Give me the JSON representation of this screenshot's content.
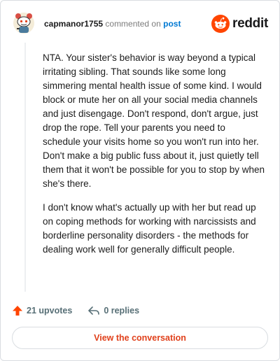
{
  "comment": {
    "username": "capmanor1755",
    "action_text": "commented on",
    "post_link": "post",
    "paragraphs": [
      "NTA. Your sister's behavior is way beyond a typical irritating sibling. That sounds like some long simmering mental health issue of some kind. I would block or mute her on all your social media channels and just disengage. Don't respond, don't argue, just drop the rope. Tell your parents you need to schedule your visits home so you won't run into her. Don't make a big public fuss about it, just quietly tell them that it won't be possible for you to stop by when she's there.",
      "I don't know what's actually up with her but read up on coping methods for working with narcissists and borderline personality disorders - the methods for dealing work well for generally difficult people."
    ],
    "upvotes": "21 upvotes",
    "replies": "0 replies",
    "cta_label": "View the conversation"
  },
  "brand": {
    "name": "reddit",
    "color": "#ff4500"
  },
  "icons": {
    "avatar": "snoo-avatar",
    "logo": "reddit-logo-icon",
    "upvote": "upvote-arrow-icon",
    "reply": "reply-arrow-icon"
  },
  "colors": {
    "upvote": "#ff4500",
    "link": "#0079d3",
    "cta_text": "#e0401b",
    "muted": "#7c7c7c"
  }
}
